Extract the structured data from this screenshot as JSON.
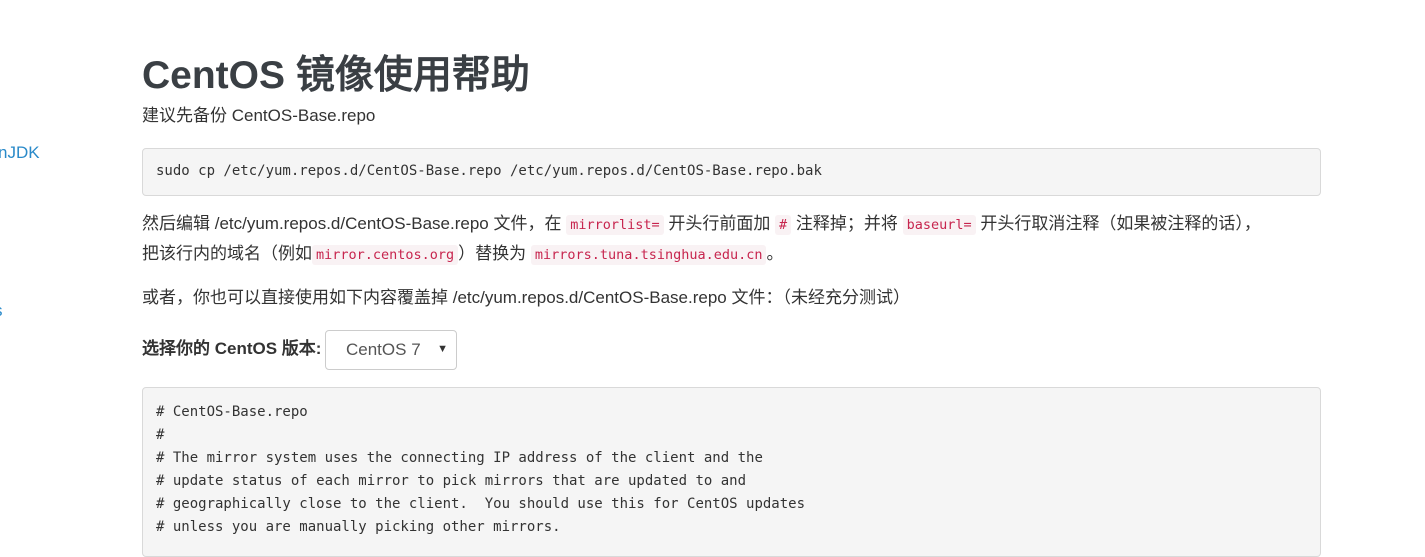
{
  "sidebar": {
    "items": [
      {
        "label": "nJDK"
      },
      {
        "label": "s"
      }
    ]
  },
  "page": {
    "title": "CentOS 镜像使用帮助",
    "backup_intro": "建议先备份 CentOS-Base.repo",
    "backup_command": "sudo cp /etc/yum.repos.d/CentOS-Base.repo /etc/yum.repos.d/CentOS-Base.repo.bak",
    "edit_para": {
      "t1": "然后编辑 /etc/yum.repos.d/CentOS-Base.repo 文件，在 ",
      "c1": "mirrorlist=",
      "t2": " 开头行前面加 ",
      "c2": "#",
      "t3": " 注释掉；并将 ",
      "c3": "baseurl=",
      "t4": " 开头行取消注释（如果被注释的话），",
      "t5": "把该行内的域名（例如",
      "c4": "mirror.centos.org",
      "t6": "）替换为 ",
      "c5": "mirrors.tuna.tsinghua.edu.cn",
      "t7": "。"
    },
    "alt_para": "或者，你也可以直接使用如下内容覆盖掉 /etc/yum.repos.d/CentOS-Base.repo 文件：（未经充分测试）",
    "version_label": "选择你的 CentOS 版本:",
    "version_select": {
      "selected": "CentOS 7",
      "arrow": "▼"
    },
    "repo_file_lines": [
      "# CentOS-Base.repo",
      "#",
      "# The mirror system uses the connecting IP address of the client and the",
      "# update status of each mirror to pick mirrors that are updated to and",
      "# geographically close to the client.  You should use this for CentOS updates",
      "# unless you are manually picking other mirrors."
    ]
  },
  "colors": {
    "link": "#2a8ac9",
    "code_inline": "#c7254e",
    "code_inline_bg": "#f9f2f4",
    "pre_bg": "#f5f5f5"
  }
}
